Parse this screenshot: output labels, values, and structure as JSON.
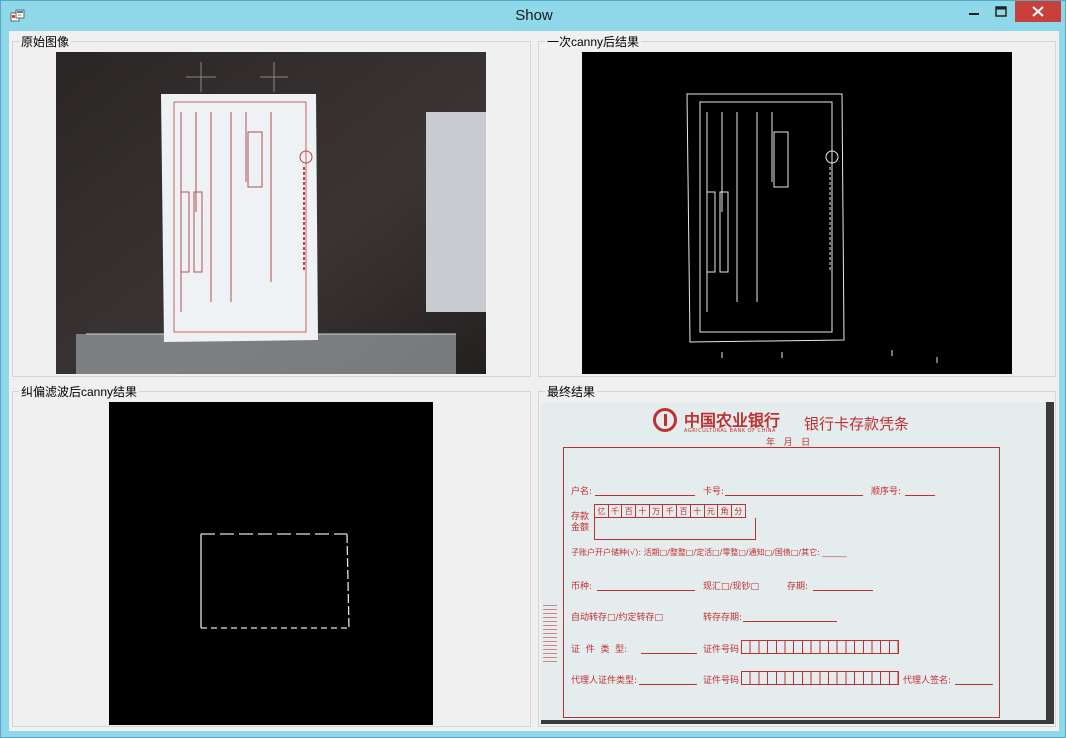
{
  "window": {
    "title": "Show"
  },
  "groups": [
    {
      "label": "原始图像"
    },
    {
      "label": "一次canny后结果"
    },
    {
      "label": "纠偏滤波后canny结果"
    },
    {
      "label": "最终结果"
    }
  ],
  "receipt": {
    "bank_name": "中国农业银行",
    "bank_name_en": "AGRICULTURAL BANK OF CHINA",
    "doc_title": "银行卡存款凭条",
    "date_line": "年   月   日",
    "account_name_label": "户名:",
    "card_no_label": "卡号:",
    "seq_no_label": "顺序号:",
    "amount_label": "存款金额",
    "digits": [
      "亿",
      "千",
      "百",
      "十",
      "万",
      "千",
      "百",
      "十",
      "元",
      "角",
      "分"
    ],
    "sub_account_line": "子账户开户储种(√): 活期□/整整□/定活□/零整□/通知□/国债□/其它: ______",
    "currency_label": "币种:",
    "cash_label": "现汇□/现钞□",
    "term_label": "存期:",
    "auto_roll_label": "自动转存□/约定转存□",
    "roll_term_label": "转存存期:",
    "id_type_label": "证  件  类  型:",
    "id_no_label": "证件号码",
    "agent_id_type_label": "代理人证件类型:",
    "agent_id_no_label": "证件号码",
    "agent_sign_label": "代理人签名:"
  }
}
